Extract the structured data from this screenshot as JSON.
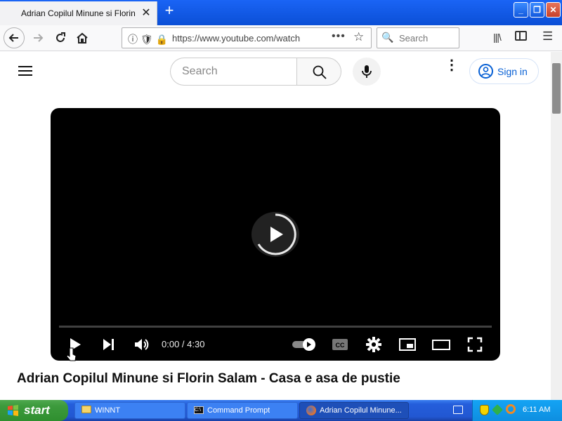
{
  "browser": {
    "tab_title": "Adrian Copilul Minune si Florin Salam - Casa e asa de pustie",
    "url": "https://www.youtube.com/watch",
    "search_placeholder": "Search"
  },
  "youtube": {
    "search_placeholder": "Search",
    "sign_in_label": "Sign in",
    "player": {
      "time": "0:00 / 4:30",
      "progress": 0.0
    },
    "video_title": "Adrian Copilul Minune si Florin Salam - Casa e asa de pustie"
  },
  "taskbar": {
    "start_label": "start",
    "tasks": [
      {
        "label": "WINNT",
        "icon": "folder-icon"
      },
      {
        "label": "Command Prompt",
        "icon": "cmd-icon"
      },
      {
        "label": "Adrian Copilul Minune...",
        "icon": "firefox-icon"
      }
    ],
    "clock": "6:11 AM"
  },
  "colors": {
    "yt_blue": "#065fd4",
    "xp_taskbar": "#245edb",
    "xp_start": "#3c9a3c"
  }
}
